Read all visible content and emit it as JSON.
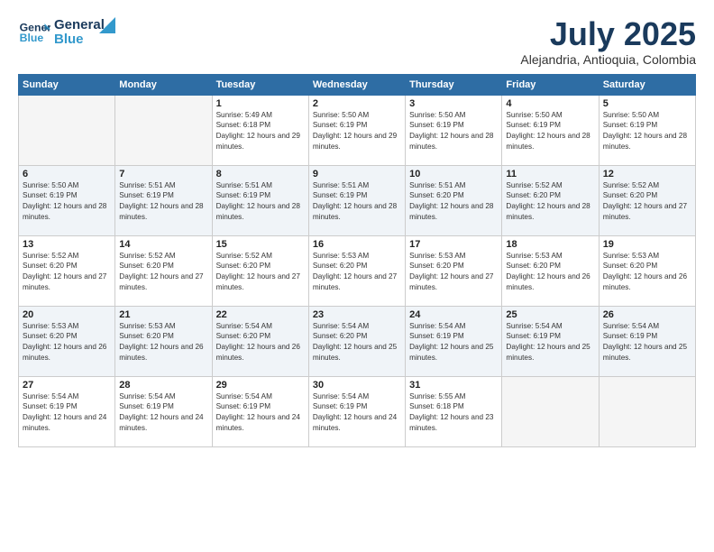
{
  "header": {
    "logo_line1": "General",
    "logo_line2": "Blue",
    "title": "July 2025",
    "subtitle": "Alejandria, Antioquia, Colombia"
  },
  "weekdays": [
    "Sunday",
    "Monday",
    "Tuesday",
    "Wednesday",
    "Thursday",
    "Friday",
    "Saturday"
  ],
  "weeks": [
    [
      {
        "day": "",
        "sunrise": "",
        "sunset": "",
        "daylight": "",
        "empty": true
      },
      {
        "day": "",
        "sunrise": "",
        "sunset": "",
        "daylight": "",
        "empty": true
      },
      {
        "day": "1",
        "sunrise": "Sunrise: 5:49 AM",
        "sunset": "Sunset: 6:18 PM",
        "daylight": "Daylight: 12 hours and 29 minutes."
      },
      {
        "day": "2",
        "sunrise": "Sunrise: 5:50 AM",
        "sunset": "Sunset: 6:19 PM",
        "daylight": "Daylight: 12 hours and 29 minutes."
      },
      {
        "day": "3",
        "sunrise": "Sunrise: 5:50 AM",
        "sunset": "Sunset: 6:19 PM",
        "daylight": "Daylight: 12 hours and 28 minutes."
      },
      {
        "day": "4",
        "sunrise": "Sunrise: 5:50 AM",
        "sunset": "Sunset: 6:19 PM",
        "daylight": "Daylight: 12 hours and 28 minutes."
      },
      {
        "day": "5",
        "sunrise": "Sunrise: 5:50 AM",
        "sunset": "Sunset: 6:19 PM",
        "daylight": "Daylight: 12 hours and 28 minutes."
      }
    ],
    [
      {
        "day": "6",
        "sunrise": "Sunrise: 5:50 AM",
        "sunset": "Sunset: 6:19 PM",
        "daylight": "Daylight: 12 hours and 28 minutes."
      },
      {
        "day": "7",
        "sunrise": "Sunrise: 5:51 AM",
        "sunset": "Sunset: 6:19 PM",
        "daylight": "Daylight: 12 hours and 28 minutes."
      },
      {
        "day": "8",
        "sunrise": "Sunrise: 5:51 AM",
        "sunset": "Sunset: 6:19 PM",
        "daylight": "Daylight: 12 hours and 28 minutes."
      },
      {
        "day": "9",
        "sunrise": "Sunrise: 5:51 AM",
        "sunset": "Sunset: 6:19 PM",
        "daylight": "Daylight: 12 hours and 28 minutes."
      },
      {
        "day": "10",
        "sunrise": "Sunrise: 5:51 AM",
        "sunset": "Sunset: 6:20 PM",
        "daylight": "Daylight: 12 hours and 28 minutes."
      },
      {
        "day": "11",
        "sunrise": "Sunrise: 5:52 AM",
        "sunset": "Sunset: 6:20 PM",
        "daylight": "Daylight: 12 hours and 28 minutes."
      },
      {
        "day": "12",
        "sunrise": "Sunrise: 5:52 AM",
        "sunset": "Sunset: 6:20 PM",
        "daylight": "Daylight: 12 hours and 27 minutes."
      }
    ],
    [
      {
        "day": "13",
        "sunrise": "Sunrise: 5:52 AM",
        "sunset": "Sunset: 6:20 PM",
        "daylight": "Daylight: 12 hours and 27 minutes."
      },
      {
        "day": "14",
        "sunrise": "Sunrise: 5:52 AM",
        "sunset": "Sunset: 6:20 PM",
        "daylight": "Daylight: 12 hours and 27 minutes."
      },
      {
        "day": "15",
        "sunrise": "Sunrise: 5:52 AM",
        "sunset": "Sunset: 6:20 PM",
        "daylight": "Daylight: 12 hours and 27 minutes."
      },
      {
        "day": "16",
        "sunrise": "Sunrise: 5:53 AM",
        "sunset": "Sunset: 6:20 PM",
        "daylight": "Daylight: 12 hours and 27 minutes."
      },
      {
        "day": "17",
        "sunrise": "Sunrise: 5:53 AM",
        "sunset": "Sunset: 6:20 PM",
        "daylight": "Daylight: 12 hours and 27 minutes."
      },
      {
        "day": "18",
        "sunrise": "Sunrise: 5:53 AM",
        "sunset": "Sunset: 6:20 PM",
        "daylight": "Daylight: 12 hours and 26 minutes."
      },
      {
        "day": "19",
        "sunrise": "Sunrise: 5:53 AM",
        "sunset": "Sunset: 6:20 PM",
        "daylight": "Daylight: 12 hours and 26 minutes."
      }
    ],
    [
      {
        "day": "20",
        "sunrise": "Sunrise: 5:53 AM",
        "sunset": "Sunset: 6:20 PM",
        "daylight": "Daylight: 12 hours and 26 minutes."
      },
      {
        "day": "21",
        "sunrise": "Sunrise: 5:53 AM",
        "sunset": "Sunset: 6:20 PM",
        "daylight": "Daylight: 12 hours and 26 minutes."
      },
      {
        "day": "22",
        "sunrise": "Sunrise: 5:54 AM",
        "sunset": "Sunset: 6:20 PM",
        "daylight": "Daylight: 12 hours and 26 minutes."
      },
      {
        "day": "23",
        "sunrise": "Sunrise: 5:54 AM",
        "sunset": "Sunset: 6:20 PM",
        "daylight": "Daylight: 12 hours and 25 minutes."
      },
      {
        "day": "24",
        "sunrise": "Sunrise: 5:54 AM",
        "sunset": "Sunset: 6:19 PM",
        "daylight": "Daylight: 12 hours and 25 minutes."
      },
      {
        "day": "25",
        "sunrise": "Sunrise: 5:54 AM",
        "sunset": "Sunset: 6:19 PM",
        "daylight": "Daylight: 12 hours and 25 minutes."
      },
      {
        "day": "26",
        "sunrise": "Sunrise: 5:54 AM",
        "sunset": "Sunset: 6:19 PM",
        "daylight": "Daylight: 12 hours and 25 minutes."
      }
    ],
    [
      {
        "day": "27",
        "sunrise": "Sunrise: 5:54 AM",
        "sunset": "Sunset: 6:19 PM",
        "daylight": "Daylight: 12 hours and 24 minutes."
      },
      {
        "day": "28",
        "sunrise": "Sunrise: 5:54 AM",
        "sunset": "Sunset: 6:19 PM",
        "daylight": "Daylight: 12 hours and 24 minutes."
      },
      {
        "day": "29",
        "sunrise": "Sunrise: 5:54 AM",
        "sunset": "Sunset: 6:19 PM",
        "daylight": "Daylight: 12 hours and 24 minutes."
      },
      {
        "day": "30",
        "sunrise": "Sunrise: 5:54 AM",
        "sunset": "Sunset: 6:19 PM",
        "daylight": "Daylight: 12 hours and 24 minutes."
      },
      {
        "day": "31",
        "sunrise": "Sunrise: 5:55 AM",
        "sunset": "Sunset: 6:18 PM",
        "daylight": "Daylight: 12 hours and 23 minutes."
      },
      {
        "day": "",
        "sunrise": "",
        "sunset": "",
        "daylight": "",
        "empty": true
      },
      {
        "day": "",
        "sunrise": "",
        "sunset": "",
        "daylight": "",
        "empty": true
      }
    ]
  ]
}
